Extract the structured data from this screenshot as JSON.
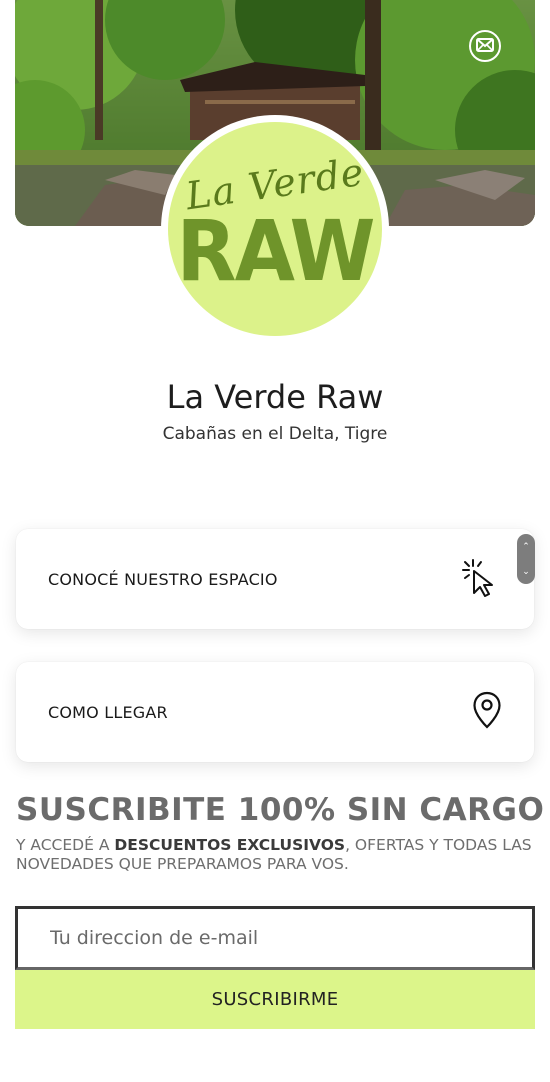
{
  "profile": {
    "logo_script": "La Verde",
    "logo_wordmark": "RAW",
    "title": "La Verde Raw",
    "subtitle": "Cabañas en el Delta, Tigre"
  },
  "links": [
    {
      "label": "CONOCÉ NUESTRO ESPACIO",
      "icon": "cursor-click-icon"
    },
    {
      "label": "COMO LLEGAR",
      "icon": "map-pin-icon"
    }
  ],
  "subscribe": {
    "heading": "SUSCRIBITE 100% SIN CARGO",
    "text_prefix": "Y ACCEDÉ A ",
    "text_bold": "DESCUENTOS EXCLUSIVOS",
    "text_suffix": ", OFERTAS Y TODAS LAS NOVEDADES QUE PREPARAMOS PARA VOS.",
    "email_placeholder": "Tu direccion de e-mail",
    "button_label": "SUSCRIBIRME"
  },
  "colors": {
    "accent_green": "#dcf58a",
    "logo_text_green": "#6f942a"
  }
}
